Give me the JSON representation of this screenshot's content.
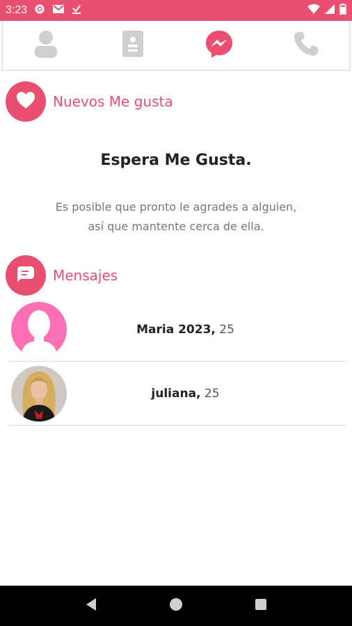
{
  "status_bar": {
    "time": "3:23"
  },
  "tabs": [
    {
      "name": "profile"
    },
    {
      "name": "contacts"
    },
    {
      "name": "messenger",
      "active": true
    },
    {
      "name": "calls"
    }
  ],
  "likes_section": {
    "title": "Nuevos Me gusta"
  },
  "empty_state": {
    "title": "Espera Me Gusta.",
    "description_line1": "Es posible que pronto le agrades a alguien,",
    "description_line2": "así que mantente cerca de ella."
  },
  "messages_section": {
    "title": "Mensajes"
  },
  "messages": [
    {
      "name": "Maria 2023,",
      "age": " 25"
    },
    {
      "name": "juliana,",
      "age": " 25"
    }
  ],
  "colors": {
    "accent": "#ea4f70",
    "inactive_icon": "#cfcfcf"
  }
}
